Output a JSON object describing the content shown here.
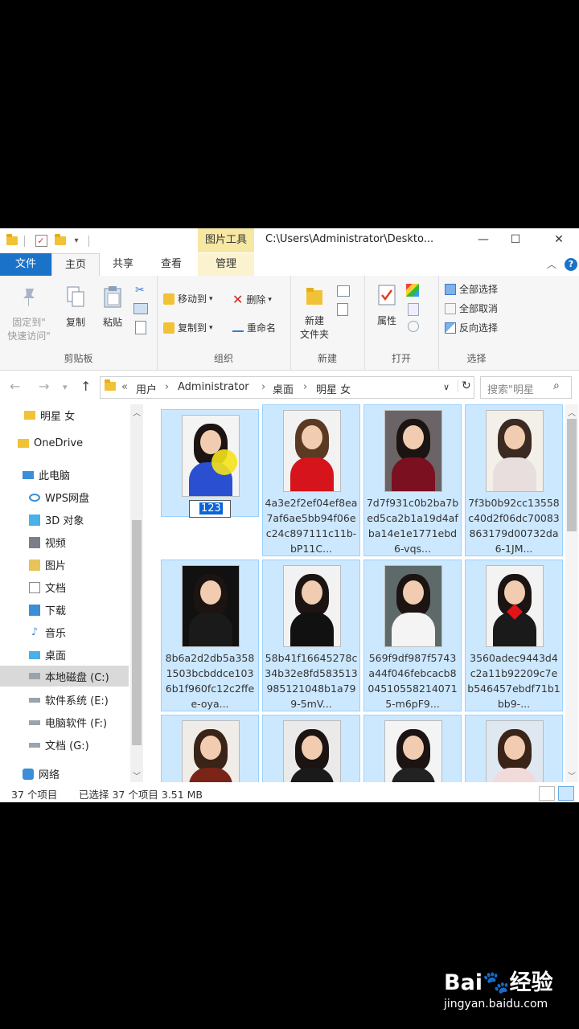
{
  "titlebar": {
    "picture_tools": "图片工具",
    "path": "C:\\Users\\Administrator\\Deskto...",
    "minimize": "—",
    "maximize": "☐",
    "close": "✕"
  },
  "tabs": {
    "file": "文件",
    "home": "主页",
    "share": "共享",
    "view": "查看",
    "manage": "管理"
  },
  "ribbon": {
    "clipboard": {
      "label": "剪贴板",
      "pin": "固定到\"\n快速访问\"",
      "pin_line1": "固定到\"",
      "pin_line2": "快速访问\"",
      "copy": "复制",
      "paste": "粘贴"
    },
    "organize": {
      "label": "组织",
      "move_to": "移动到",
      "copy_to": "复制到",
      "delete": "删除",
      "rename": "重命名"
    },
    "new": {
      "label": "新建",
      "new_folder_line1": "新建",
      "new_folder_line2": "文件夹"
    },
    "open": {
      "label": "打开",
      "properties": "属性"
    },
    "select": {
      "label": "选择",
      "select_all": "全部选择",
      "select_none": "全部取消",
      "invert": "反向选择"
    }
  },
  "address": {
    "prefix": "«",
    "crumbs": [
      "用户",
      "Administrator",
      "桌面",
      "明星 女"
    ],
    "search_placeholder": "搜索\"明星"
  },
  "nav": {
    "items": [
      "明星 女",
      "OneDrive",
      "此电脑",
      "WPS网盘",
      "3D 对象",
      "视频",
      "图片",
      "文档",
      "下载",
      "音乐",
      "桌面",
      "本地磁盘 (C:)",
      "软件系统 (E:)",
      "电脑软件 (F:)",
      "文档 (G:)",
      "网络"
    ]
  },
  "files": [
    {
      "name": "123",
      "renaming": true
    },
    {
      "name": "4a3e2f2ef04ef8ea7af6ae5bb94f06ec24c897111c11b-bP11C..."
    },
    {
      "name": "7d7f931c0b2ba7bed5ca2b1a19d4afba14e1e1771ebd6-vqs..."
    },
    {
      "name": "7f3b0b92cc13558c40d2f06dc70083863179d00732da6-1JM..."
    },
    {
      "name": "8b6a2d2db5a3581503bcbddce1036b1f960fc12c2ffee-oya..."
    },
    {
      "name": "58b41f16645278c34b32e8fd583513985121048b1a799-5mV..."
    },
    {
      "name": "569f9df987f5743a44f046febcacb8045105582140715-m6pF9..."
    },
    {
      "name": "3560adec9443d4c2a11b92209c7eb546457ebdf71b1bb9-..."
    },
    {
      "name": ""
    },
    {
      "name": ""
    },
    {
      "name": ""
    },
    {
      "name": ""
    }
  ],
  "status": {
    "count": "37 个项目",
    "selected": "已选择 37 个项目  3.51 MB"
  },
  "watermark": {
    "logo": "Bai🐾经验",
    "url": "jingyan.baidu.com"
  }
}
